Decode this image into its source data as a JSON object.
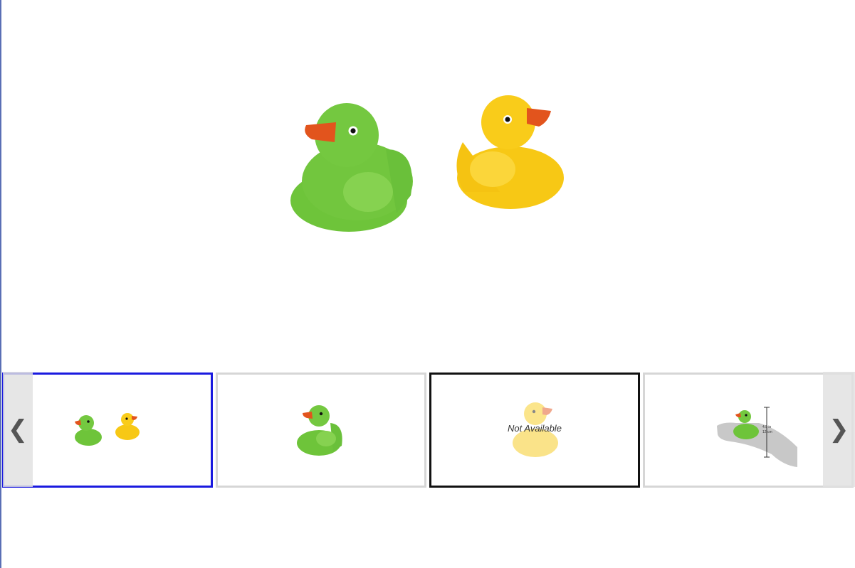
{
  "gallery": {
    "main_image": {
      "icon": "rubber-ducks-green-and-yellow"
    },
    "thumbnails": [
      {
        "icon": "two-ducks",
        "state": "selected",
        "label": ""
      },
      {
        "icon": "green-duck",
        "state": "normal",
        "label": ""
      },
      {
        "icon": "yellow-duck-faded",
        "state": "focused",
        "label": "Not Available"
      },
      {
        "icon": "duck-in-hand-size",
        "state": "normal",
        "label": ""
      }
    ],
    "nav": {
      "prev_glyph": "❮",
      "next_glyph": "❯"
    },
    "size_guide": {
      "inches": "4.9 in",
      "cm": "12 cm"
    },
    "colors": {
      "selected_border": "#1a1adf",
      "focused_border": "#111111",
      "idle_border": "#d6d6d6",
      "green_duck": "#6ec43a",
      "yellow_duck": "#f7c815",
      "beak": "#e2541d"
    }
  }
}
